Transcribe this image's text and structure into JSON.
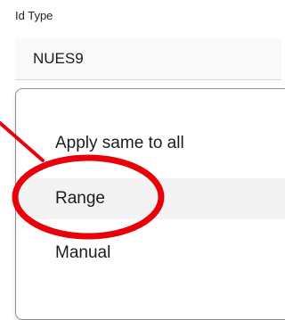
{
  "form": {
    "field_label": "Id Type",
    "field_value": "NUES9"
  },
  "dropdown": {
    "options": [
      {
        "label": "Apply same to all"
      },
      {
        "label": "Range",
        "highlighted": true
      },
      {
        "label": "Manual"
      }
    ]
  },
  "annotation": {
    "color": "#e8000b",
    "target": "Range"
  }
}
